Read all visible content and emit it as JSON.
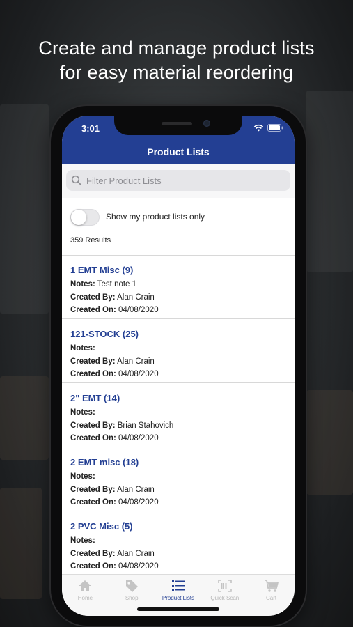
{
  "headline": {
    "line1": "Create and manage product lists",
    "line2": "for easy material reordering"
  },
  "status_bar": {
    "time": "3:01",
    "icons": [
      "wifi-icon",
      "battery-icon"
    ]
  },
  "nav": {
    "title": "Product Lists"
  },
  "search": {
    "placeholder": "Filter Product Lists",
    "value": ""
  },
  "filter": {
    "toggle_label": "Show my product lists only",
    "toggle_on": false,
    "results": "359 Results"
  },
  "labels": {
    "notes": "Notes:",
    "created_by": "Created By:",
    "created_on": "Created On:"
  },
  "lists": [
    {
      "title": "1 EMT Misc (9)",
      "notes": "Test note 1",
      "created_by": "Alan Crain",
      "created_on": "04/08/2020"
    },
    {
      "title": "121-STOCK (25)",
      "notes": "",
      "created_by": "Alan Crain",
      "created_on": "04/08/2020"
    },
    {
      "title": "2\" EMT (14)",
      "notes": "",
      "created_by": "Brian Stahovich",
      "created_on": "04/08/2020"
    },
    {
      "title": "2 EMT misc (18)",
      "notes": "",
      "created_by": "Alan Crain",
      "created_on": "04/08/2020"
    },
    {
      "title": "2 PVC Misc (5)",
      "notes": "",
      "created_by": "Alan Crain",
      "created_on": "04/08/2020"
    }
  ],
  "tabs": [
    {
      "label": "Home",
      "icon": "home-icon",
      "active": false
    },
    {
      "label": "Shop",
      "icon": "tag-icon",
      "active": false
    },
    {
      "label": "Product Lists",
      "icon": "list-icon",
      "active": true
    },
    {
      "label": "Quick Scan",
      "icon": "barcode-scan-icon",
      "active": false
    },
    {
      "label": "Cart",
      "icon": "cart-icon",
      "active": false
    }
  ],
  "colors": {
    "brand_blue": "#233f93",
    "inactive_tab": "#b8b8b8"
  }
}
